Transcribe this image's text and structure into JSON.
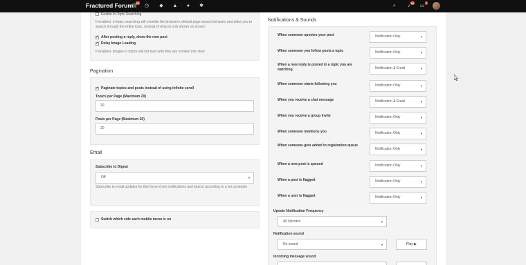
{
  "header": {
    "brand": "Fractured Forum",
    "unread_badge": "20",
    "notifications_badge": "66",
    "chats_badge": "1"
  },
  "left": {
    "reading": {
      "infinite_search_label": "Enable In-Topic Searching",
      "infinite_search_help": "If enabled, in-topic searching will override the browser's default page search behavior and allow you to search through the entire topic, instead of what is only shown on screen",
      "follow_after_post_label": "After posting a reply, show the new post",
      "delay_image_label": "Delay Image Loading",
      "delay_image_help": "If enabled, images in topics will not load until they are scrolled into view"
    },
    "pagination": {
      "title": "Pagination",
      "infinite_scroll_label": "Paginate topics and posts instead of using infinite scroll",
      "topics_per_page_label": "Topics per Page (Maximum 20)",
      "topics_per_page_value": "20",
      "posts_per_page_label": "Posts per Page (Maximum 20)",
      "posts_per_page_value": "20"
    },
    "email": {
      "title": "Email",
      "digest_label": "Subscribe to Digest",
      "digest_value": "Off",
      "digest_help": "Subscribe to email updates for this forum (new notifications and topics) according to a set schedule"
    },
    "mobile": {
      "switch_label": "Switch which side each mobile menu is on"
    }
  },
  "right": {
    "title": "Notifications & Sounds",
    "rows": [
      {
        "label": "When someone upvotes your post",
        "value": "Notification Only"
      },
      {
        "label": "When someone you follow posts a topic",
        "value": "Notification Only"
      },
      {
        "label": "When a new reply is posted in a topic you are watching",
        "value": "Notification & Email"
      },
      {
        "label": "When someone starts following you",
        "value": "Notification Only"
      },
      {
        "label": "When you receive a chat message",
        "value": "Notification & Email"
      },
      {
        "label": "When you receive a group invite",
        "value": "Notification Only"
      },
      {
        "label": "When someone mentions you",
        "value": "Notification Only"
      },
      {
        "label": "When someone gets added to registration queue",
        "value": "Notification Only"
      },
      {
        "label": "When a new post is queued",
        "value": "Notification Only"
      },
      {
        "label": "When a post is flagged",
        "value": "Notification Only"
      },
      {
        "label": "When a user is flagged",
        "value": "Notification Only"
      }
    ],
    "upvote_freq_label": "Upvote Notification Frequency",
    "upvote_freq_value": "All Upvotes",
    "notif_sound_label": "Notification sound",
    "notif_sound_value": "No sound",
    "play_label": "Play ▶",
    "incoming_sound_label": "Incoming message sound"
  }
}
